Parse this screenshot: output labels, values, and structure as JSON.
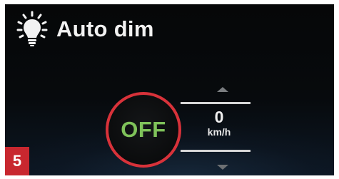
{
  "header": {
    "title": "Auto dim",
    "icon": "lightbulb-icon"
  },
  "auto_dim": {
    "toggle_label": "OFF",
    "speed_value": "0",
    "speed_unit": "km/h"
  },
  "figure_badge": "5",
  "colors": {
    "toggle_ring": "#d8323a",
    "toggle_text": "#7fc25a",
    "badge_bg": "#c8272f",
    "screen_bg": "#070a0d"
  }
}
